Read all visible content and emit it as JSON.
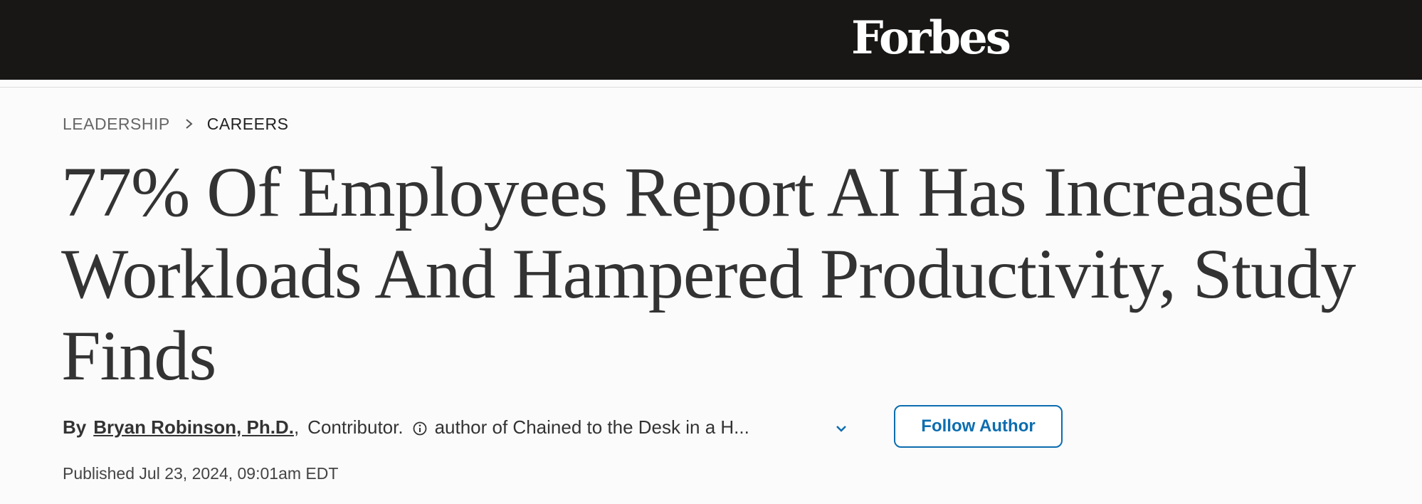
{
  "header": {
    "logo_text": "Forbes",
    "background": "#181716"
  },
  "breadcrumb": {
    "primary": "LEADERSHIP",
    "secondary": "CAREERS",
    "separator_icon": "chevron-right-icon"
  },
  "article": {
    "headline": "77% Of Employees Report AI Has Increased Workloads And Hampered Productivity, Study Finds",
    "byline": {
      "by_label": "By",
      "author": "Bryan Robinson, Ph.D.",
      "comma": ",",
      "role": "Contributor.",
      "info_icon": "info-circle-icon",
      "bio": "author of Chained to the Desk in a H...",
      "expand_icon": "chevron-down-icon"
    },
    "follow_label": "Follow Author",
    "published": "Published Jul 23, 2024, 09:01am EDT"
  },
  "colors": {
    "accent": "#0c6daf",
    "text": "#333333",
    "page_background": "#fbfbfb"
  }
}
